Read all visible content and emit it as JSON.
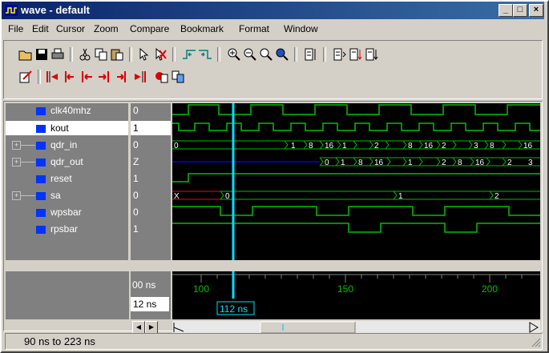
{
  "window": {
    "title": "wave - default",
    "min": "_",
    "max": "□",
    "close": "×"
  },
  "menu": [
    "File",
    "Edit",
    "Cursor",
    "Zoom",
    "Compare",
    "Bookmark",
    "Format",
    "Window"
  ],
  "signals": [
    {
      "name": "clk40mhz",
      "value": "0",
      "expandable": false,
      "selected": false
    },
    {
      "name": "kout",
      "value": "1",
      "expandable": false,
      "selected": true
    },
    {
      "name": "qdr_in",
      "value": "0",
      "expandable": true,
      "selected": false
    },
    {
      "name": "qdr_out",
      "value": "Z",
      "expandable": true,
      "selected": false
    },
    {
      "name": "reset",
      "value": "1",
      "expandable": false,
      "selected": false
    },
    {
      "name": "sa",
      "value": "0",
      "expandable": true,
      "selected": false
    },
    {
      "name": "wpsbar",
      "value": "0",
      "expandable": false,
      "selected": false
    },
    {
      "name": "rpsbar",
      "value": "1",
      "expandable": false,
      "selected": false
    }
  ],
  "bus_labels": {
    "qdr_in": [
      "0",
      "1",
      "8",
      "16",
      "1",
      "2",
      "8",
      "16",
      "2",
      "3",
      "8",
      "16"
    ],
    "qdr_out": [
      "0",
      "1",
      "8",
      "16",
      "1",
      "2",
      "8",
      "16",
      "2",
      "3"
    ],
    "sa": [
      "X",
      "0",
      "1",
      "2"
    ]
  },
  "timeline": {
    "now_label": "00 ns",
    "cursor_value": "12 ns",
    "cursor_label": "112 ns",
    "ticks": [
      "100",
      "150",
      "200"
    ]
  },
  "status": {
    "range": "90 ns to 223 ns"
  },
  "colors": {
    "signal": "#00c000",
    "cursor": "#00e0ff",
    "bus_z": "#0000ff",
    "unknown": "#ff0000"
  }
}
